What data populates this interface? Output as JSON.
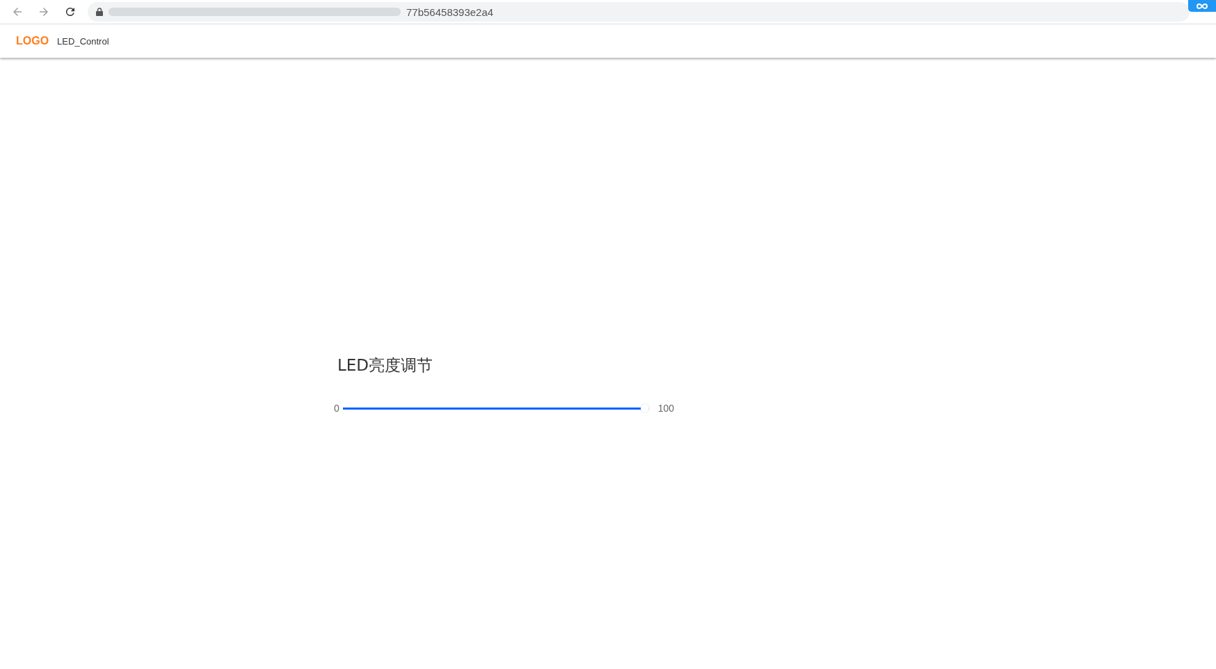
{
  "browser": {
    "address_visible": "77b56458393e2a4"
  },
  "navbar": {
    "logo": "LOGO",
    "title": "LED_Control"
  },
  "brightness": {
    "title": "LED亮度调节",
    "min_label": "0",
    "max_label": "100",
    "level": 1.0
  }
}
